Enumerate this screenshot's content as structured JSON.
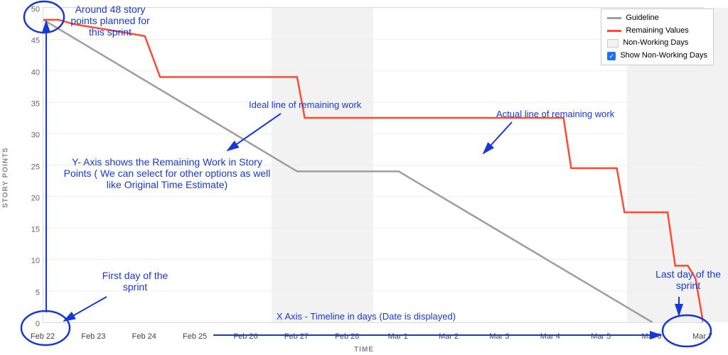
{
  "yAxisLabel": "STORY POINTS",
  "xAxisLabel": "TIME",
  "legend": {
    "guideline": "Guideline",
    "remaining": "Remaining Values",
    "nonworking": "Non-Working Days",
    "showNW": "Show Non-Working Days"
  },
  "annotations": {
    "startPoints": "Around 48 story points planned for this sprint",
    "ideal": "Ideal line of remaining work",
    "actual": "Actual line of remaining work",
    "yaxis": "Y- Axis shows the Remaining Work in Story Points ( We can select for other options as well like Original Time Estimate)",
    "firstDay": "First day of the sprint",
    "lastDay": "Last day of the sprint",
    "xaxis": "X Axis - Timeline in days (Date is displayed)"
  },
  "chart_data": {
    "type": "line",
    "x": [
      "Feb 22",
      "Feb 23",
      "Feb 24",
      "Feb 25",
      "Feb 26",
      "Feb 27",
      "Feb 28",
      "Mar 1",
      "Mar 2",
      "Mar 3",
      "Mar 4",
      "Mar 5",
      "Mar 6",
      "Mar 7"
    ],
    "ylim": [
      0,
      50
    ],
    "yticks": [
      0,
      5,
      10,
      15,
      20,
      25,
      30,
      35,
      40,
      45,
      50
    ],
    "non_working_days": [
      "Feb 27",
      "Feb 28",
      "Mar 6",
      "Mar 7"
    ],
    "series": [
      {
        "name": "Guideline",
        "color": "#9e9e9e",
        "points": [
          [
            0,
            48.1
          ],
          [
            5,
            24
          ],
          [
            7,
            24
          ],
          [
            12,
            0
          ]
        ]
      },
      {
        "name": "Remaining Values",
        "color": "#ff4b33",
        "step": true,
        "points": [
          [
            0,
            48.1
          ],
          [
            0.3,
            48.1
          ],
          [
            0.6,
            47.4
          ],
          [
            0.9,
            47
          ],
          [
            1.5,
            46.2
          ],
          [
            2.0,
            45.5
          ],
          [
            2.3,
            39
          ],
          [
            5.0,
            39
          ],
          [
            5.15,
            32.5
          ],
          [
            10.25,
            32.5
          ],
          [
            10.4,
            24.5
          ],
          [
            11.3,
            24.5
          ],
          [
            11.45,
            17.5
          ],
          [
            12.3,
            17.5
          ],
          [
            12.45,
            9
          ],
          [
            12.7,
            9
          ],
          [
            12.85,
            7
          ],
          [
            13,
            0
          ]
        ]
      }
    ],
    "xlabel": "TIME",
    "ylabel": "STORY POINTS",
    "title": ""
  }
}
